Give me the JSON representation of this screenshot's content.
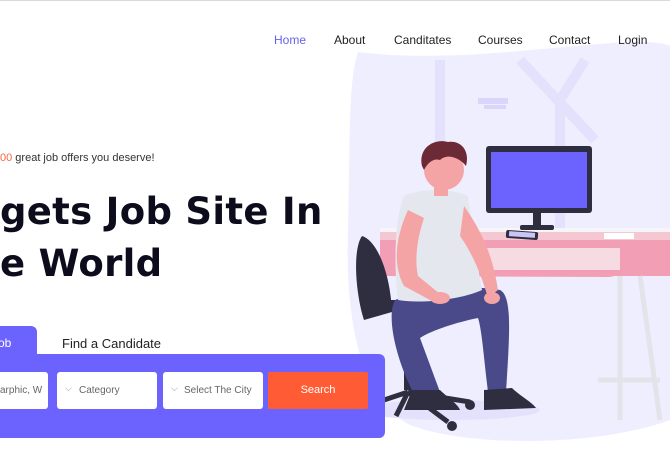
{
  "nav": {
    "items": [
      {
        "label": "Home",
        "active": true
      },
      {
        "label": "About"
      },
      {
        "label": "Canditates"
      },
      {
        "label": "Courses"
      },
      {
        "label": "Contact"
      },
      {
        "label": "Login"
      }
    ]
  },
  "hero": {
    "promo_highlight": "00",
    "promo_text": " great job offers you deserve!",
    "headline_line1": "gets Job Site In",
    "headline_line2": "e World"
  },
  "search": {
    "tabs": [
      {
        "label": "ob",
        "active": true
      },
      {
        "label": "Find a Candidate"
      }
    ],
    "keyword_value": "arphic, W",
    "category_label": "Category",
    "city_label": "Select The City",
    "search_label": "Search"
  },
  "colors": {
    "accent": "#6c63ff",
    "nav_active": "#6661e8",
    "search_button": "#ff5c35",
    "highlight": "#f06a3c"
  },
  "icons": [
    "chevron-down-icon",
    "person-at-desk-illustration"
  ]
}
